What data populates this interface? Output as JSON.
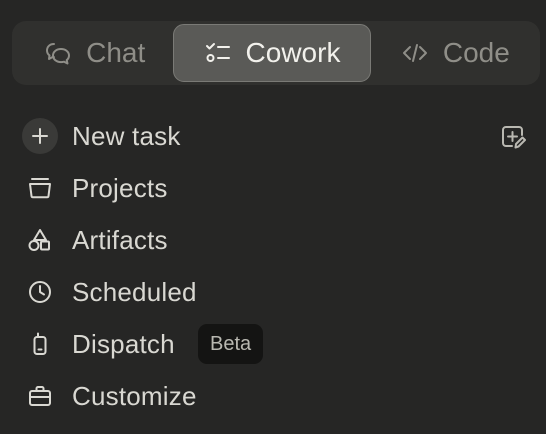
{
  "mode_switcher": {
    "tabs": [
      {
        "label": "Chat",
        "icon": "chat-bubble-icon",
        "selected": false
      },
      {
        "label": "Cowork",
        "icon": "checklist-icon",
        "selected": true
      },
      {
        "label": "Code",
        "icon": "code-brackets-icon",
        "selected": false
      }
    ]
  },
  "nav": {
    "new_task": {
      "label": "New task",
      "icon": "plus-icon"
    },
    "compose_icon": "compose-icon",
    "items": [
      {
        "label": "Projects",
        "icon": "folder-icon"
      },
      {
        "label": "Artifacts",
        "icon": "shapes-icon"
      },
      {
        "label": "Scheduled",
        "icon": "clock-icon"
      },
      {
        "label": "Dispatch",
        "icon": "phone-icon",
        "badge": "Beta"
      },
      {
        "label": "Customize",
        "icon": "briefcase-icon"
      }
    ]
  },
  "colors": {
    "background": "#262625",
    "switcher_bg": "#30302e",
    "selected_tab_bg": "#5a5a57",
    "text": "#d9d8d2",
    "muted_text": "#8f8e88",
    "badge_bg": "#141413"
  }
}
